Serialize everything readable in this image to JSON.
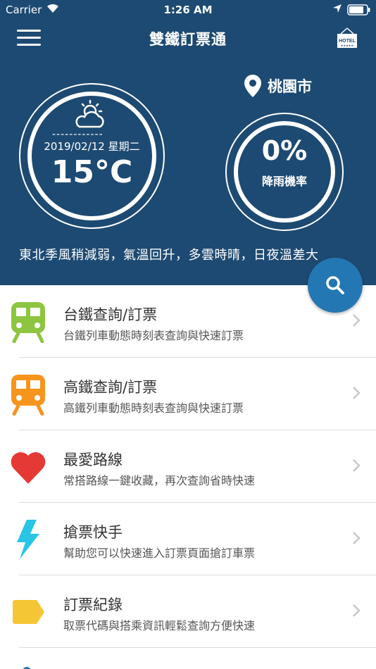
{
  "status_bar": {
    "carrier": "Carrier",
    "time": "1:26 AM"
  },
  "nav": {
    "title": "雙鐵訂票通",
    "hotel_icon_label": "HOTEL"
  },
  "weather": {
    "dashes": "------------",
    "date": "2019/02/12 星期二",
    "temperature": "15°C",
    "city": "桃園市",
    "rain_percent": "0%",
    "rain_label": "降雨機率",
    "forecast": "東北季風稍減弱，氣溫回升，多雲時晴，日夜溫差大"
  },
  "colors": {
    "header_bg": "#1d4a72",
    "fab": "#2377b3",
    "tra_green": "#8dc540",
    "thsr_orange": "#f7941d",
    "heart_red": "#e53935",
    "bolt_cyan": "#29c5e6",
    "tag_yellow": "#f4c534"
  },
  "menu": [
    {
      "icon": "train-green-icon",
      "title": "台鐵查詢/訂票",
      "subtitle": "台鐵列車動態時刻表查詢與快速訂票"
    },
    {
      "icon": "train-orange-icon",
      "title": "高鐵查詢/訂票",
      "subtitle": "高鐵列車動態時刻表查詢與快速訂票"
    },
    {
      "icon": "heart-icon",
      "title": "最愛路線",
      "subtitle": "常搭路線一鍵收藏，再次查詢省時快速"
    },
    {
      "icon": "lightning-icon",
      "title": "搶票快手",
      "subtitle": "幫助您可以快速進入訂票頁面搶訂車票"
    },
    {
      "icon": "tag-icon",
      "title": "訂票紀錄",
      "subtitle": "取票代碼與搭乘資訊輕鬆查詢方便快速"
    }
  ]
}
